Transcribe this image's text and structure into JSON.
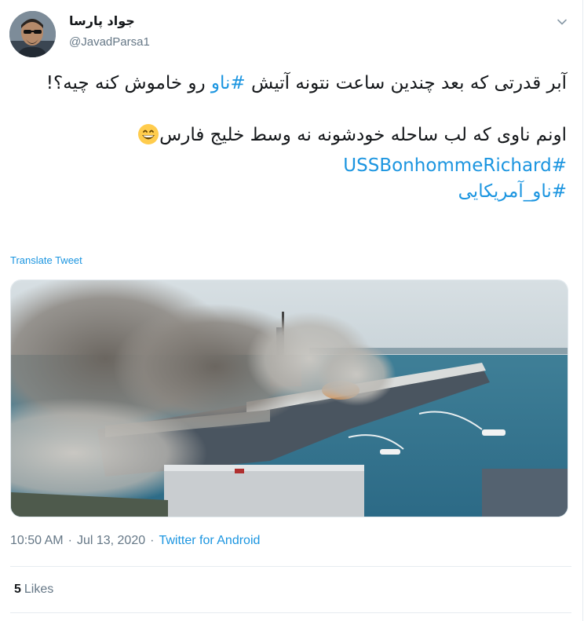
{
  "tweet": {
    "author": {
      "display_name": "جواد پارسا",
      "handle": "@JavadParsa1",
      "avatar_icon": "user-avatar"
    },
    "menu_icon": "chevron-down-icon",
    "text": {
      "line1_before": "آبر قدرتی که بعد چندین ساعت نتونه آتیش ",
      "hashtag_inline": "#ناو",
      "line1_after": " رو خاموش کنه چیه؟!",
      "line2": "اونم ناوی که لب ساحله خودشونه نه وسط خلیج فارس",
      "emoji_icon": "grinning-face-emoji",
      "hashtag_1": "#USSBonhommeRichard",
      "hashtag_2": "#ناو_آمریکایی"
    },
    "translate_label": "Translate Tweet",
    "time": "10:50 AM",
    "date": "Jul 13, 2020",
    "source": "Twitter for Android",
    "likes_count": "5",
    "likes_label": "Likes",
    "colors": {
      "link": "#1b95e0",
      "text": "#14171a",
      "secondary": "#657786",
      "border": "#e6ecf0"
    }
  }
}
